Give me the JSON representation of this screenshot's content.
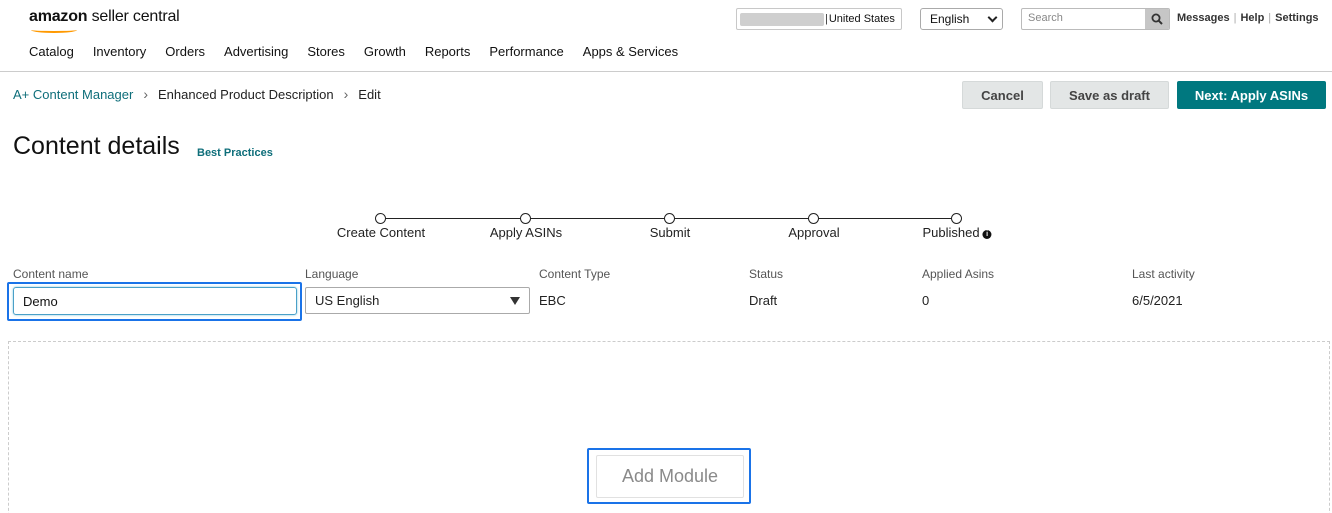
{
  "header": {
    "logo_brand": "amazon",
    "logo_rest": " seller central",
    "marketplace": "United States",
    "language": "English",
    "search_placeholder": "Search",
    "links": [
      "Messages",
      "Help",
      "Settings"
    ]
  },
  "nav": [
    "Catalog",
    "Inventory",
    "Orders",
    "Advertising",
    "Stores",
    "Growth",
    "Reports",
    "Performance",
    "Apps & Services"
  ],
  "breadcrumb": {
    "items": [
      "A+ Content Manager",
      "Enhanced Product Description",
      "Edit"
    ]
  },
  "actions": {
    "cancel": "Cancel",
    "save_draft": "Save as draft",
    "next": "Next: Apply ASINs"
  },
  "page": {
    "title": "Content details",
    "best_practices": "Best Practices"
  },
  "stepper": [
    "Create Content",
    "Apply ASINs",
    "Submit",
    "Approval",
    "Published"
  ],
  "details": {
    "content_name_label": "Content name",
    "content_name_value": "Demo",
    "language_label": "Language",
    "language_value": "US English",
    "content_type_label": "Content Type",
    "content_type_value": "EBC",
    "status_label": "Status",
    "status_value": "Draft",
    "applied_asins_label": "Applied Asins",
    "applied_asins_value": "0",
    "last_activity_label": "Last activity",
    "last_activity_value": "6/5/2021"
  },
  "module": {
    "add_label": "Add Module"
  },
  "colors": {
    "accent_teal": "#00787f",
    "link_teal": "#0e6e7a",
    "focus_blue": "#1a73e8",
    "logo_orange": "#ff9900"
  }
}
